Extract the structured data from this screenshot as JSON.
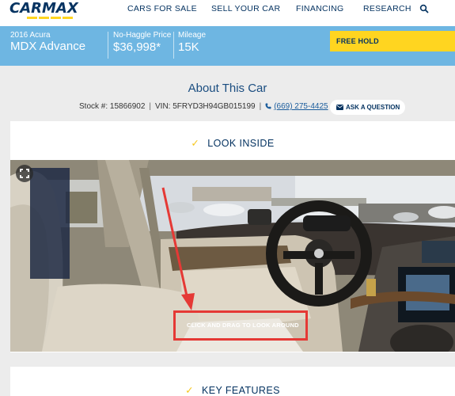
{
  "brand": {
    "logo_text": "CARMAX",
    "accent_color": "#ffd520",
    "navy_color": "#053361"
  },
  "nav": {
    "items": [
      {
        "label": "CARS FOR SALE"
      },
      {
        "label": "SELL YOUR CAR"
      },
      {
        "label": "FINANCING"
      },
      {
        "label": "RESEARCH"
      }
    ],
    "search_icon": "search-icon"
  },
  "vehicle": {
    "year_make": "2016 Acura",
    "model": "MDX Advance",
    "price_label": "No-Haggle Price",
    "price": "$36,998",
    "price_footnote": "*",
    "mileage_label": "Mileage",
    "mileage": "15K",
    "hold_button": "FREE HOLD"
  },
  "about": {
    "title": "About This Car",
    "stock": "Stock #: 15866902",
    "vin": "VIN: 5FRYD3H94GB015199",
    "phone": "(669) 275-4425",
    "ask_button": "ASK A QUESTION"
  },
  "look_inside": {
    "title": "LOOK INSIDE",
    "drag_hint": "CLICK AND DRAG TO LOOK AROUND",
    "fullscreen_icon": "fullscreen-icon",
    "annotation_color": "#e53935"
  },
  "key_features": {
    "title": "KEY FEATURES"
  }
}
